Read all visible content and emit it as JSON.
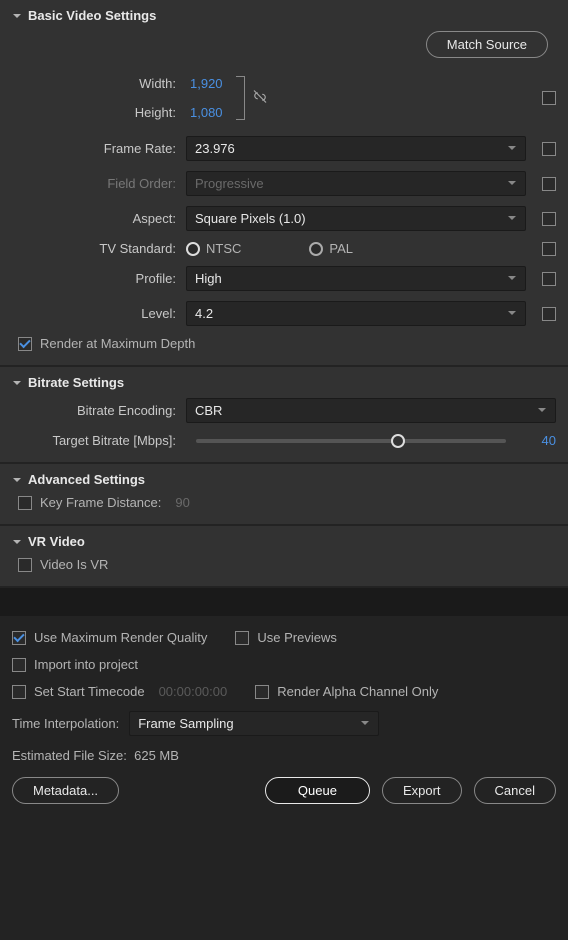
{
  "basic": {
    "title": "Basic Video Settings",
    "match_source": "Match Source",
    "width_label": "Width:",
    "width_value": "1,920",
    "height_label": "Height:",
    "height_value": "1,080",
    "frame_rate_label": "Frame Rate:",
    "frame_rate_value": "23.976",
    "field_order_label": "Field Order:",
    "field_order_value": "Progressive",
    "aspect_label": "Aspect:",
    "aspect_value": "Square Pixels (1.0)",
    "tv_standard_label": "TV Standard:",
    "tv_ntsc": "NTSC",
    "tv_pal": "PAL",
    "profile_label": "Profile:",
    "profile_value": "High",
    "level_label": "Level:",
    "level_value": "4.2",
    "render_max_depth": "Render at Maximum Depth"
  },
  "bitrate": {
    "title": "Bitrate Settings",
    "encoding_label": "Bitrate Encoding:",
    "encoding_value": "CBR",
    "target_label": "Target Bitrate [Mbps]:",
    "target_value": "40"
  },
  "advanced": {
    "title": "Advanced Settings",
    "keyframe_label": "Key Frame Distance:",
    "keyframe_value": "90"
  },
  "vr": {
    "title": "VR Video",
    "is_vr": "Video Is VR"
  },
  "bottom": {
    "max_quality": "Use Maximum Render Quality",
    "use_previews": "Use Previews",
    "import_project": "Import into project",
    "set_start_tc": "Set Start Timecode",
    "tc_value": "00:00:00:00",
    "render_alpha": "Render Alpha Channel Only",
    "time_interp_label": "Time Interpolation:",
    "time_interp_value": "Frame Sampling",
    "est_label": "Estimated File Size:",
    "est_value": "625 MB",
    "metadata": "Metadata...",
    "queue": "Queue",
    "export": "Export",
    "cancel": "Cancel"
  }
}
